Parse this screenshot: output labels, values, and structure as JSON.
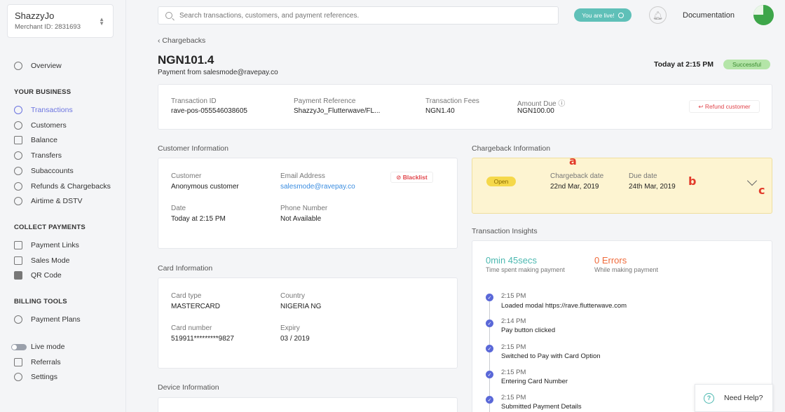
{
  "merchant": {
    "name": "ShazzyJo",
    "id": "Merchant ID: 2831693"
  },
  "sidebar": {
    "overview": "Overview",
    "your_business": "YOUR BUSINESS",
    "business_items": [
      "Transactions",
      "Customers",
      "Balance",
      "Transfers",
      "Subaccounts",
      "Refunds & Chargebacks",
      "Airtime & DSTV"
    ],
    "collect_payments": "COLLECT PAYMENTS",
    "collect_items": [
      "Payment Links",
      "Sales Mode",
      "QR Code"
    ],
    "billing_tools": "BILLING TOOLS",
    "billing_items": [
      "Payment Plans"
    ],
    "live_mode": "Live mode",
    "referrals": "Referrals",
    "settings": "Settings",
    "active_item": "Transactions",
    "accent": "#6b74e0"
  },
  "topbar": {
    "search_placeholder": "Search transactions, customers, and payment references.",
    "live_status": "You are live!",
    "documentation": "Documentation"
  },
  "header": {
    "back": "Chargebacks",
    "amount": "NGN101.4",
    "from": "Payment from salesmode@ravepay.co",
    "time": "Today at 2:15 PM",
    "status": "Successful"
  },
  "summary": {
    "transaction_id_label": "Transaction ID",
    "transaction_id": "rave-pos-055546038605",
    "payment_ref_label": "Payment Reference",
    "payment_ref": "ShazzyJo_Flutterwave/FL...",
    "fees_label": "Transaction Fees",
    "fees": "NGN1.40",
    "amount_due_label": "Amount Due",
    "amount_due": "NGN100.00",
    "refund": "Refund customer"
  },
  "customer": {
    "section": "Customer Information",
    "customer_label": "Customer",
    "customer": "Anonymous customer",
    "email_label": "Email Address",
    "email": "salesmode@ravepay.co",
    "blacklist": "Blacklist",
    "date_label": "Date",
    "date": "Today at 2:15 PM",
    "phone_label": "Phone Number",
    "phone": "Not Available"
  },
  "card": {
    "section": "Card Information",
    "type_label": "Card type",
    "type": "MASTERCARD",
    "country_label": "Country",
    "country": "NIGERIA NG",
    "number_label": "Card number",
    "number": "519911*********9827",
    "expiry_label": "Expiry",
    "expiry": "03 / 2019"
  },
  "device": {
    "section": "Device Information"
  },
  "chargeback": {
    "section": "Chargeback Information",
    "status": "Open",
    "date_label": "Chargeback date",
    "date": "22nd Mar, 2019",
    "due_label": "Due date",
    "due": "24th Mar, 2019",
    "markers": [
      "a",
      "b",
      "c"
    ]
  },
  "insights": {
    "section": "Transaction Insights",
    "time_value": "0min 45secs",
    "time_label": "Time spent making payment",
    "errors_value": "0 Errors",
    "errors_label": "While making payment",
    "events": [
      {
        "time": "2:15 PM",
        "text": "Loaded modal https://rave.flutterwave.com"
      },
      {
        "time": "2:14 PM",
        "text": "Pay button clicked"
      },
      {
        "time": "2:15 PM",
        "text": "Switched to Pay with Card Option"
      },
      {
        "time": "2:15 PM",
        "text": "Entering Card Number"
      },
      {
        "time": "2:15 PM",
        "text": "Submitted Payment Details"
      }
    ]
  },
  "help": "Need Help?"
}
